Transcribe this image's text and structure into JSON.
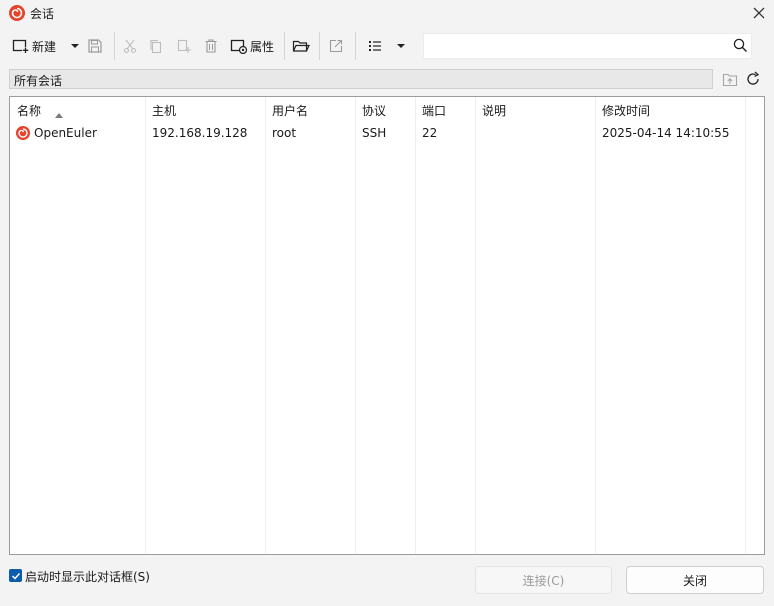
{
  "window": {
    "title": "会话",
    "close_icon": "close-icon",
    "logo_icon": "snail-logo-icon"
  },
  "toolbar": {
    "new_label": "新建",
    "properties_label": "属性",
    "icons": [
      "new-session-icon",
      "dropdown-arrow-icon",
      "save-icon",
      "cut-icon",
      "copy-icon",
      "paste-icon",
      "delete-icon",
      "properties-icon",
      "open-folder-icon",
      "export-icon",
      "list-view-icon",
      "dropdown-arrow-icon"
    ],
    "search": {
      "value": "",
      "placeholder": ""
    }
  },
  "path_bar": {
    "label": "所有会话"
  },
  "table": {
    "columns": [
      "名称",
      "主机",
      "用户名",
      "协议",
      "端口",
      "说明",
      "修改时间"
    ],
    "sort_column": "名称",
    "sort_direction": "ascending",
    "rows": [
      {
        "name": "OpenEuler",
        "host": "192.168.19.128",
        "user": "root",
        "protocol": "SSH",
        "port": "22",
        "description": "",
        "modified": "2025-04-14 14:10:55"
      }
    ]
  },
  "footer": {
    "startup_checkbox_label": "启动时显示此对话框(S)",
    "startup_checkbox_checked": true,
    "connect_label": "连接(C)",
    "close_label": "关闭"
  },
  "colors": {
    "accent": "#0b5cad",
    "logo": "#e4432c",
    "list_border": "#9c9c9c"
  }
}
